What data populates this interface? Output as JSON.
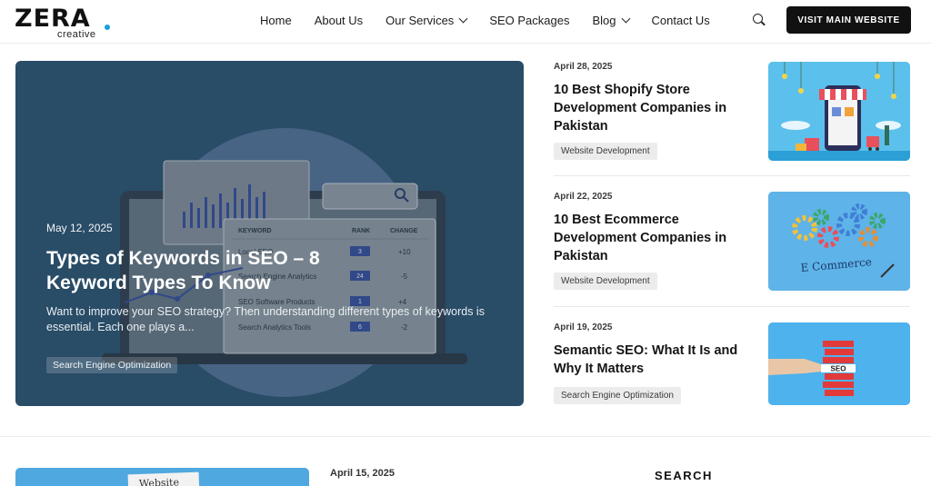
{
  "header": {
    "logo_main": "ZERA",
    "logo_sub": "creative",
    "nav": [
      {
        "label": "Home"
      },
      {
        "label": "About Us"
      },
      {
        "label": "Our Services",
        "dropdown": true
      },
      {
        "label": "SEO Packages"
      },
      {
        "label": "Blog",
        "dropdown": true
      },
      {
        "label": "Contact Us"
      }
    ],
    "search_icon": "search-icon",
    "cta_label": "VISIT MAIN WEBSITE"
  },
  "hero": {
    "date": "May 12, 2025",
    "title": "Types of Keywords in SEO – 8 Keyword Types To Know",
    "excerpt": "Want to improve your SEO strategy? Then understanding different types of keywords is essential. Each one plays a...",
    "tag": "Search Engine Optimization",
    "illustration": {
      "headers": {
        "keyword": "KEYWORD",
        "rank": "RANK",
        "change": "CHANGE"
      },
      "rows": [
        {
          "keyword": "Local SEO",
          "rank": "3",
          "change": "+10"
        },
        {
          "keyword": "Search Engine Analytics",
          "rank": "24",
          "change": "-5"
        },
        {
          "keyword": "SEO Software Products",
          "rank": "1",
          "change": "+4"
        },
        {
          "keyword": "Search Analytics Tools",
          "rank": "6",
          "change": "-2"
        }
      ]
    }
  },
  "posts": [
    {
      "date": "April 28, 2025",
      "title": "10 Best Shopify Store Development Companies in Pakistan",
      "tag": "Website Development",
      "thumb": "shopify-store-illustration"
    },
    {
      "date": "April 22, 2025",
      "title": "10 Best Ecommerce Development Companies in Pakistan",
      "tag": "Website Development",
      "thumb": "ecommerce-gears-illustration",
      "thumb_text": "E Commerce"
    },
    {
      "date": "April 19, 2025",
      "title": "Semantic SEO: What It Is and Why It Matters",
      "tag": "Search Engine Optimization",
      "thumb": "seo-blocks-illustration",
      "thumb_text": "SEO"
    }
  ],
  "bottom": {
    "thumb_text": "Website",
    "date": "April 15, 2025",
    "sidebar_heading": "SEARCH"
  }
}
